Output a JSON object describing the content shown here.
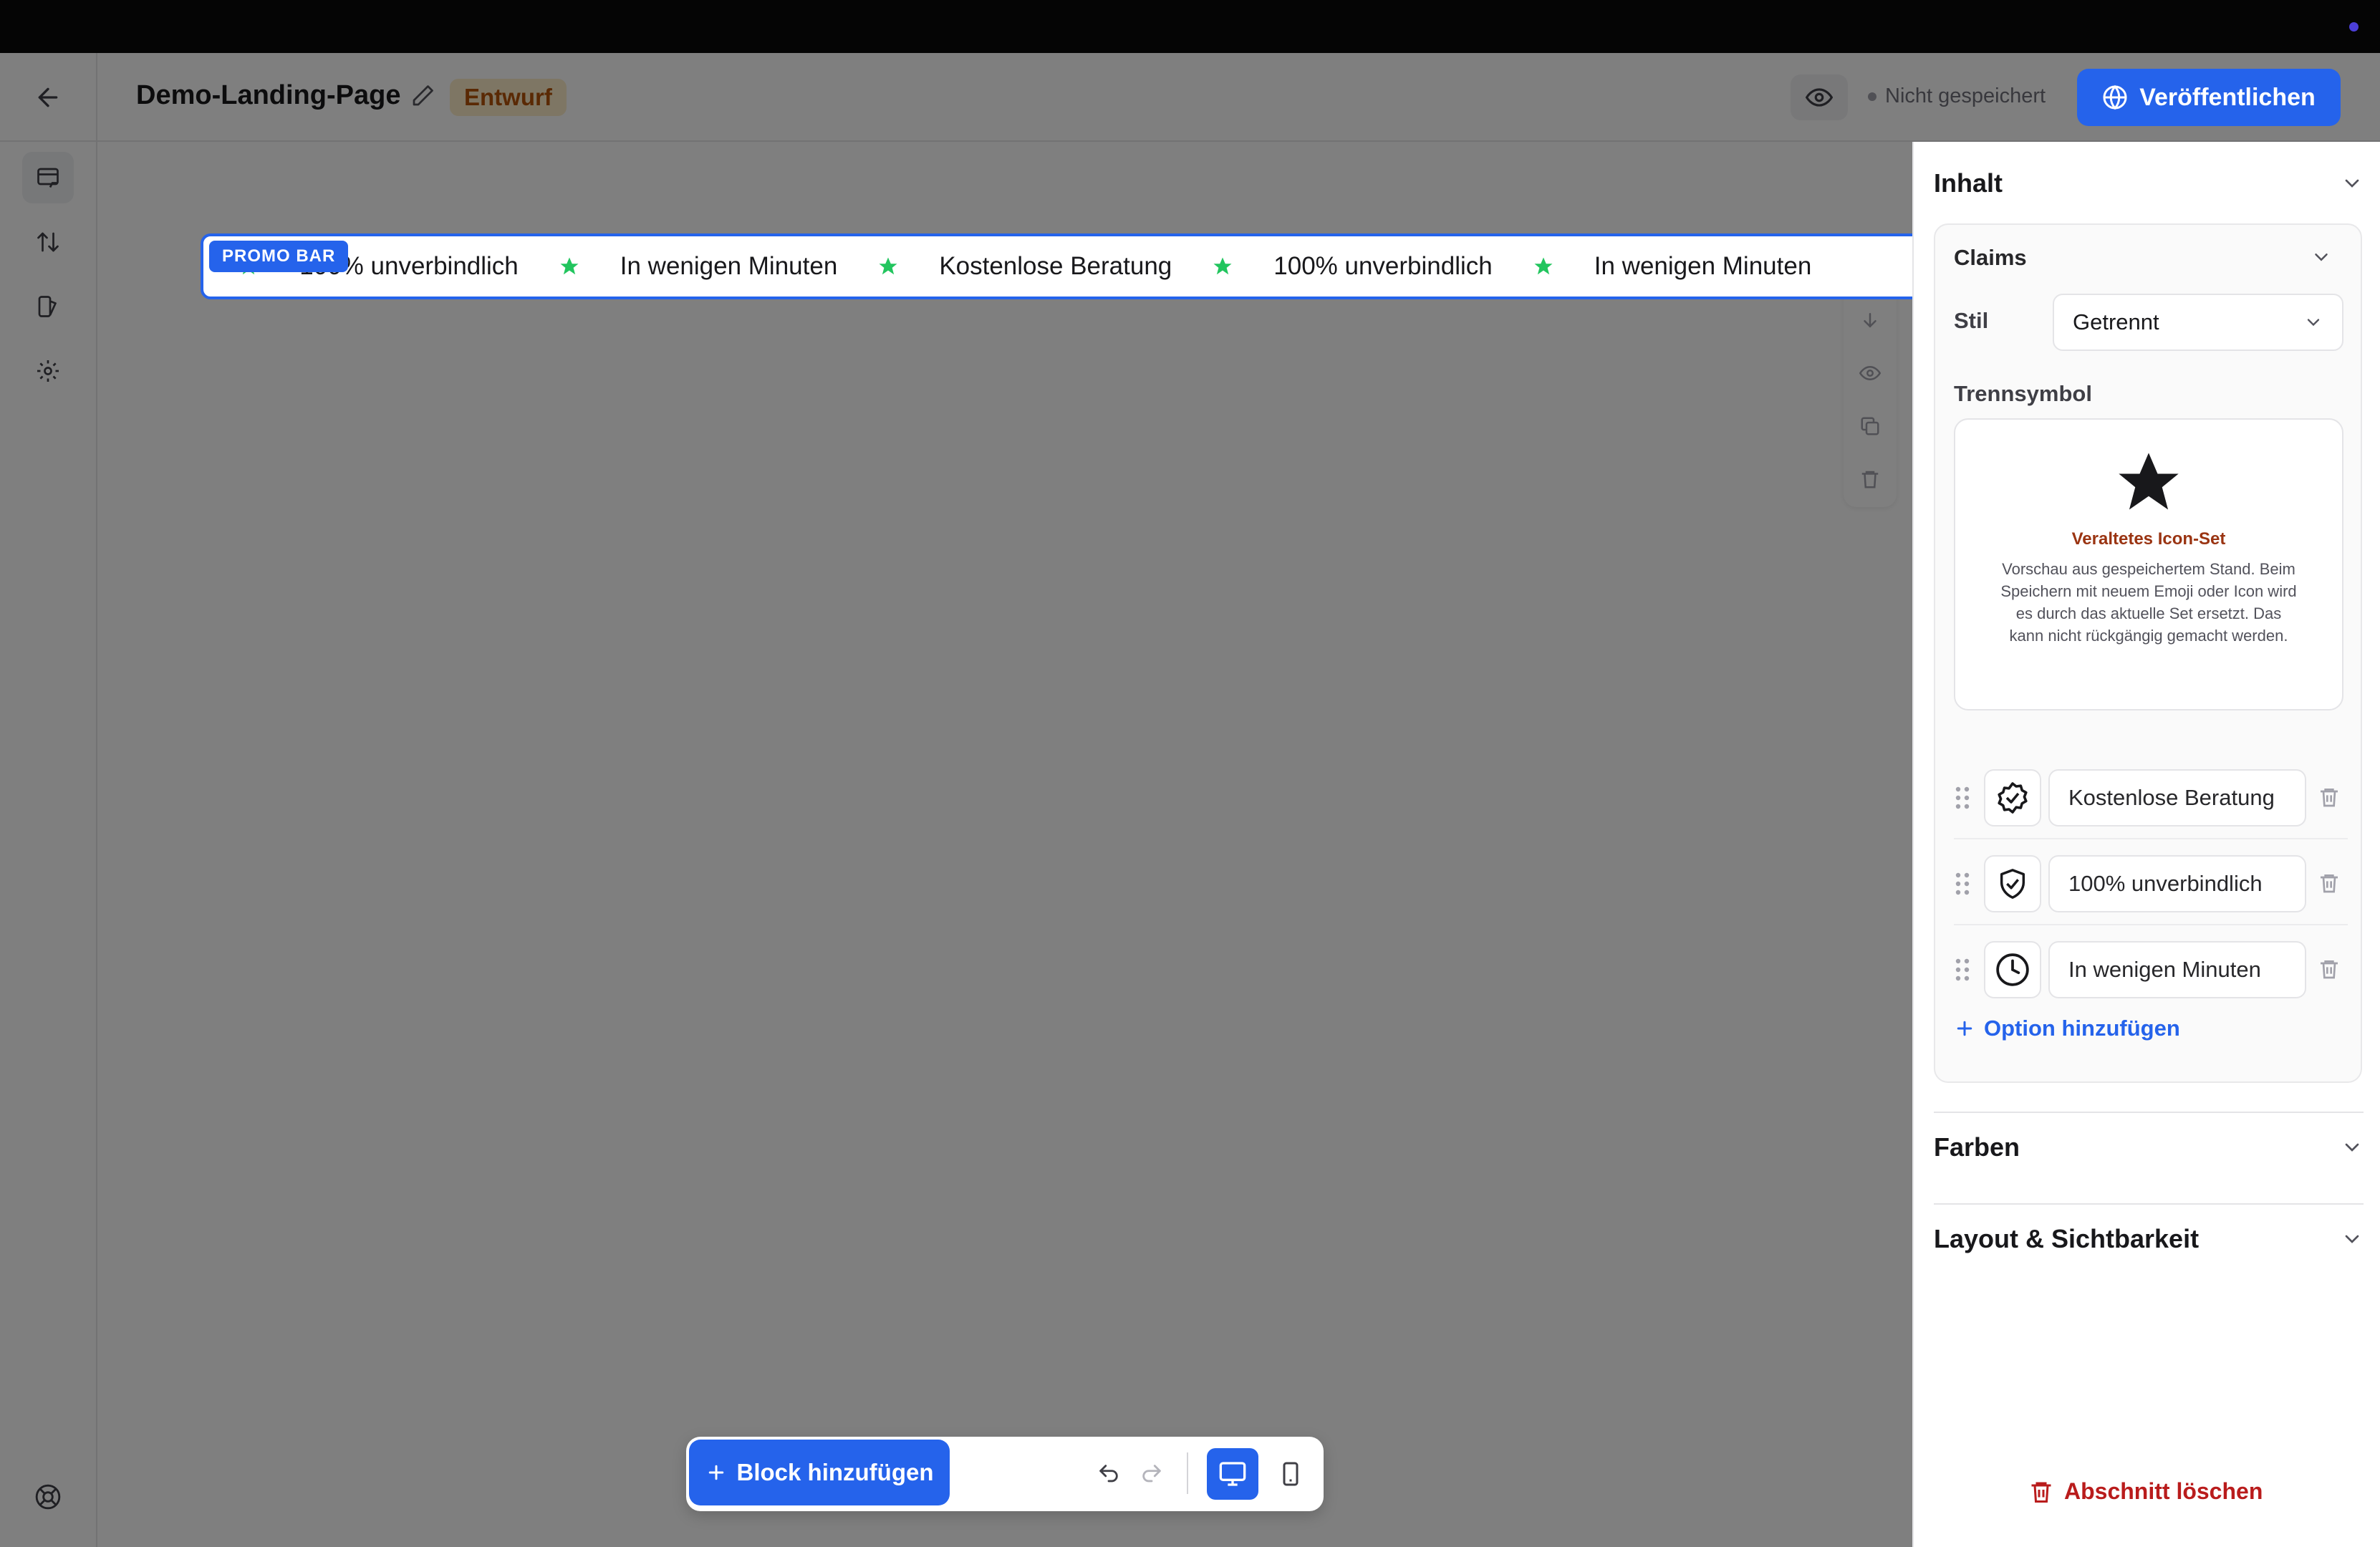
{
  "header": {
    "page_title": "Demo-Landing-Page",
    "status_badge": "Entwurf",
    "save_status": "Nicht gespeichert",
    "publish_label": "Veröffentlichen"
  },
  "canvas": {
    "promo_tag": "PROMO BAR",
    "ticker": [
      "100% unverbindlich",
      "In wenigen Minuten",
      "Kostenlose Beratung",
      "100% unverbindlich",
      "In wenigen Minuten"
    ],
    "separator_icon": "star-icon"
  },
  "toolbar": {
    "add_block_label": "Block hinzufügen"
  },
  "panel": {
    "content_title": "Inhalt",
    "claims_title": "Claims",
    "style_label": "Stil",
    "style_value": "Getrennt",
    "separator_label": "Trennsymbol",
    "legacy_title": "Veraltetes Icon-Set",
    "legacy_text": "Vorschau aus gespeichertem Stand. Beim Speichern mit neuem Emoji oder Icon wird es durch das aktuelle Set ersetzt. Das kann nicht rückgängig gemacht werden.",
    "options": [
      {
        "icon": "badge-check-icon",
        "value": "Kostenlose Beratung"
      },
      {
        "icon": "shield-check-icon",
        "value": "100% unverbindlich"
      },
      {
        "icon": "clock-icon",
        "value": "In wenigen Minuten"
      }
    ],
    "add_option_label": "Option hinzufügen",
    "colors_title": "Farben",
    "layout_title": "Layout & Sichtbarkeit",
    "delete_section_label": "Abschnitt löschen"
  },
  "colors": {
    "accent": "#2563eb",
    "star_green": "#22c55e",
    "danger": "#b91c1c",
    "draft_bg": "#fdecc8",
    "draft_text": "#b45309"
  }
}
